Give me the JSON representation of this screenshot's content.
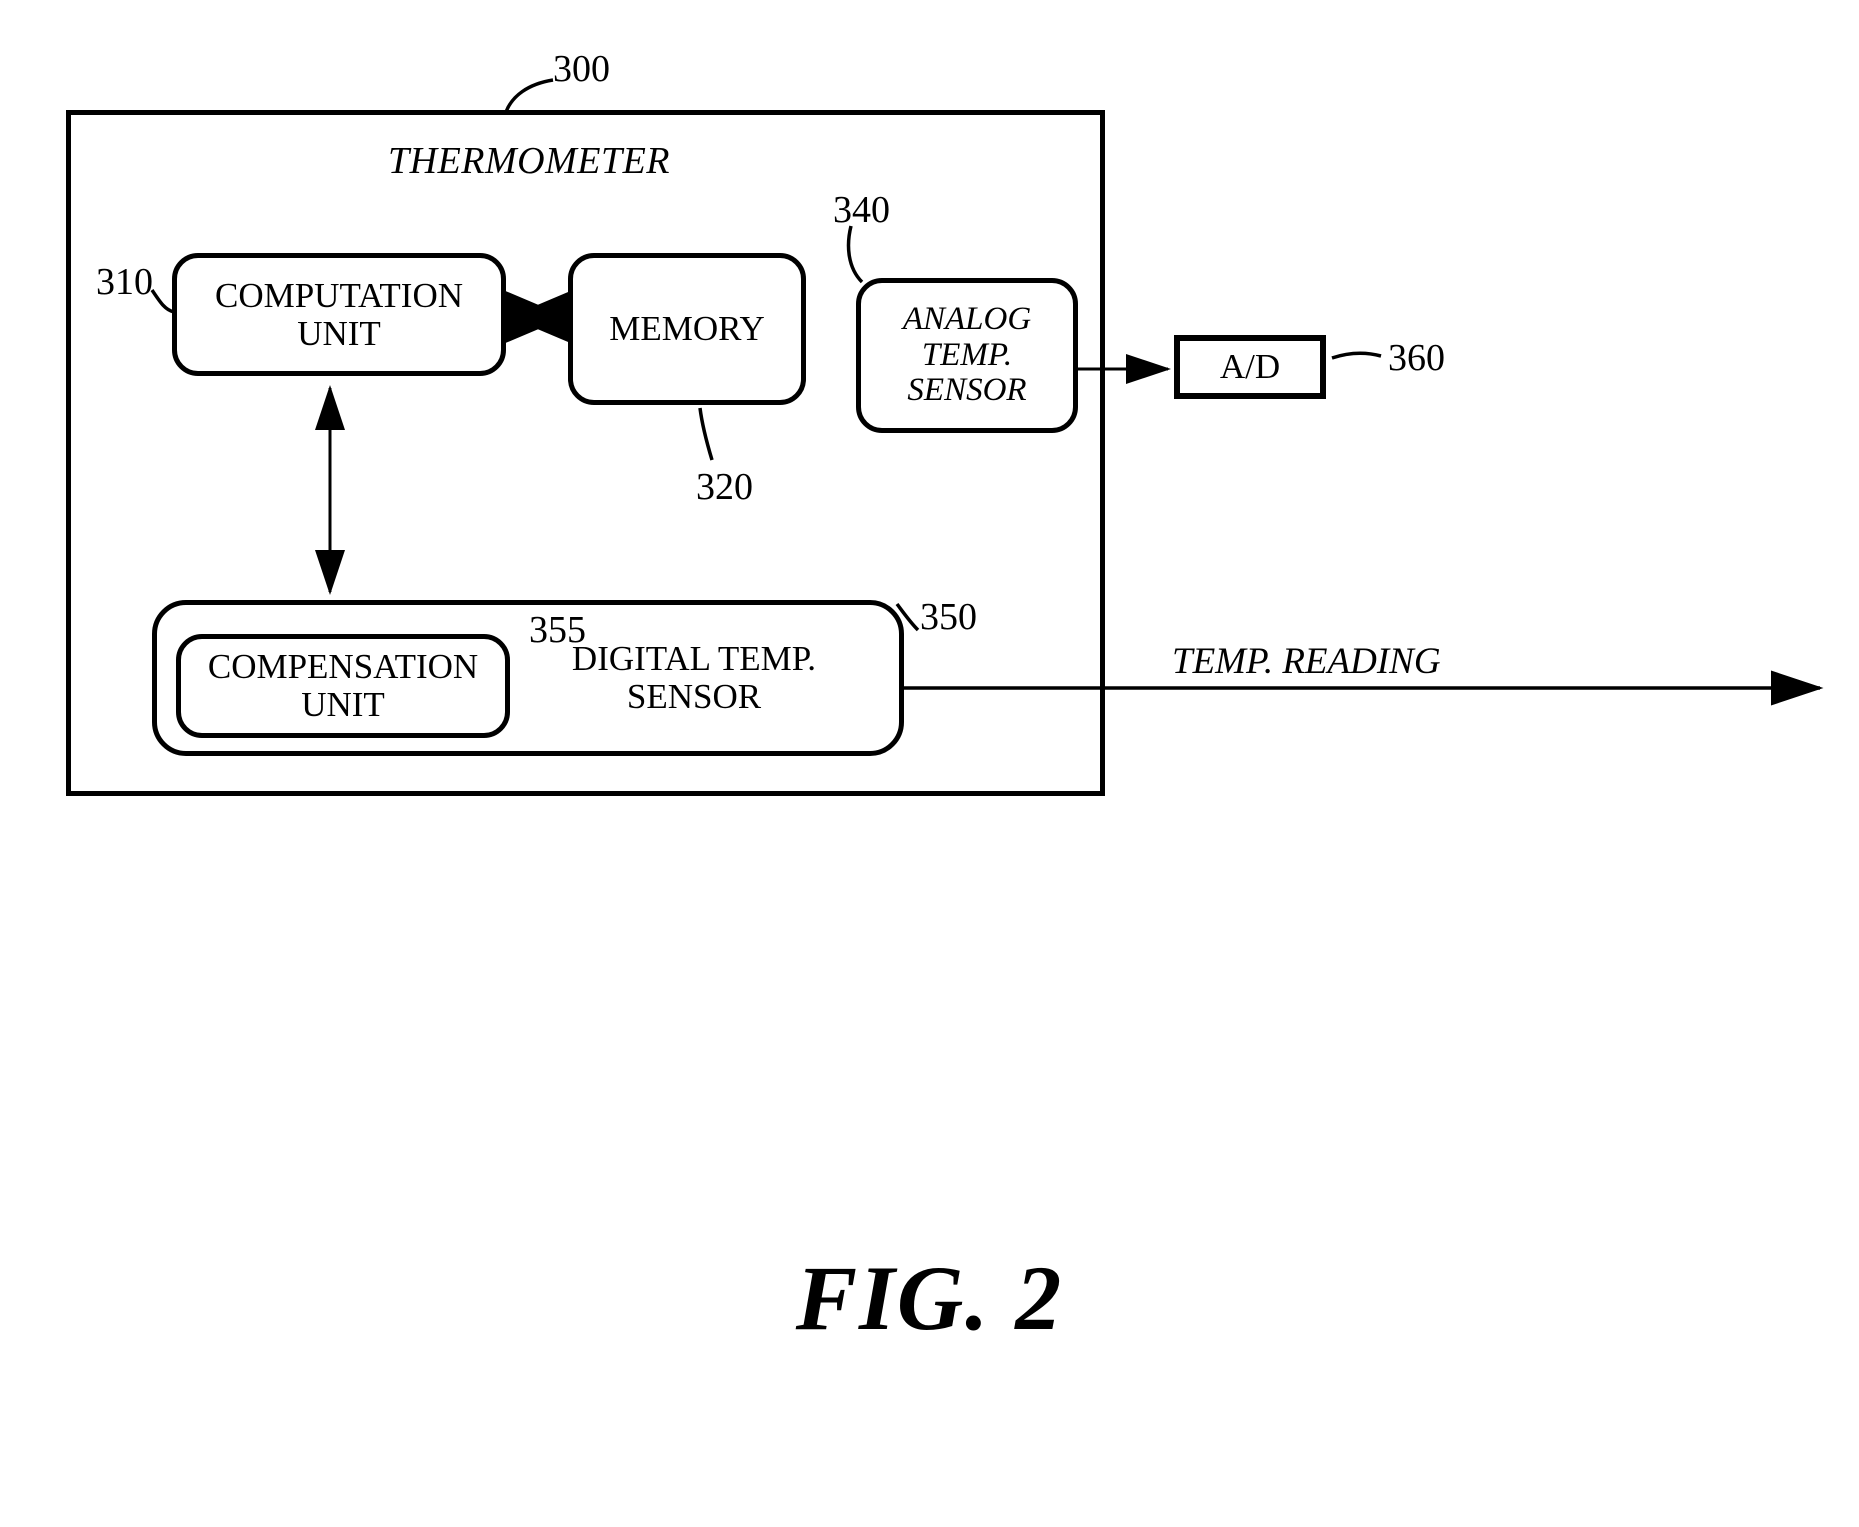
{
  "figure": {
    "caption": "FIG. 2",
    "system_title": "THERMOMETER",
    "system_ref": "300"
  },
  "blocks": [
    {
      "id": "computation-unit",
      "label": "COMPUTATION UNIT",
      "ref": "310",
      "style": "rounded"
    },
    {
      "id": "memory",
      "label": "MEMORY",
      "ref": "320",
      "style": "rounded"
    },
    {
      "id": "analog-temp-sensor",
      "label": "ANALOG TEMP. SENSOR",
      "ref": "340",
      "style": "rounded-italic"
    },
    {
      "id": "ad-converter",
      "label": "A/D",
      "ref": "360",
      "style": "rectangle"
    },
    {
      "id": "digital-temp-sensor",
      "label": "DIGITAL TEMP. SENSOR",
      "ref": "350",
      "style": "rounded"
    },
    {
      "id": "compensation-unit",
      "label": "COMPENSATION UNIT",
      "ref": "355",
      "style": "rounded"
    }
  ],
  "labels": {
    "computation_unit_line1": "COMPUTATION",
    "computation_unit_line2": "UNIT",
    "memory": "MEMORY",
    "analog_line1": "ANALOG",
    "analog_line2": "TEMP.",
    "analog_line3": "SENSOR",
    "ad": "A/D",
    "digital_line1": "DIGITAL TEMP.",
    "digital_line2": "SENSOR",
    "compensation_line1": "COMPENSATION",
    "compensation_line2": "UNIT",
    "temp_reading": "TEMP. READING"
  },
  "reference_numerals": {
    "system": "300",
    "computation_unit": "310",
    "memory": "320",
    "analog_temp_sensor": "340",
    "digital_temp_sensor": "350",
    "compensation_unit": "355",
    "ad_converter": "360"
  },
  "connections": [
    {
      "from": "computation-unit",
      "to": "memory",
      "type": "bidirectional"
    },
    {
      "from": "computation-unit",
      "to": "digital-temp-sensor",
      "type": "bidirectional"
    },
    {
      "from": "analog-temp-sensor",
      "to": "ad-converter",
      "type": "directional"
    },
    {
      "from": "digital-temp-sensor",
      "to": "temp-reading-output",
      "type": "directional"
    }
  ],
  "colors": {
    "ink": "#000000",
    "background": "#ffffff"
  }
}
